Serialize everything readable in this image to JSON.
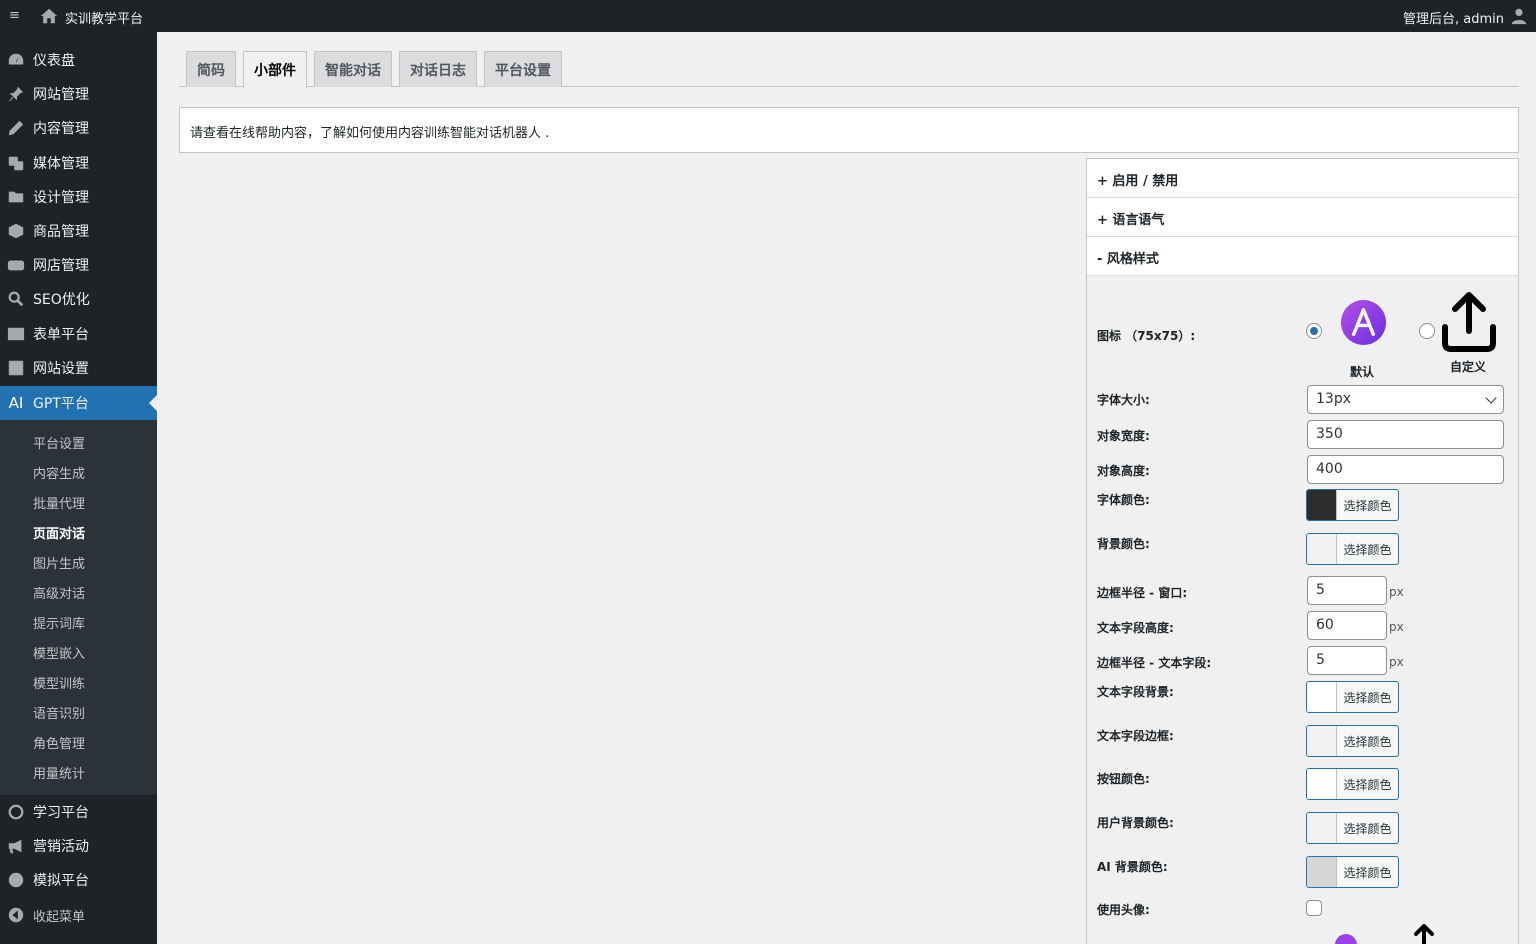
{
  "adminbar": {
    "menu_toggle_glyph": "≡",
    "site_name": "实训教学平台",
    "account_text": "管理后台, admin"
  },
  "sidebar": {
    "items": [
      {
        "label": "仪表盘",
        "icon": "dashboard-icon"
      },
      {
        "label": "网站管理",
        "icon": "pin-icon"
      },
      {
        "label": "内容管理",
        "icon": "pencil-icon"
      },
      {
        "label": "媒体管理",
        "icon": "media-icon"
      },
      {
        "label": "设计管理",
        "icon": "folder-icon"
      },
      {
        "label": "商品管理",
        "icon": "box-icon"
      },
      {
        "label": "网店管理",
        "icon": "woo-icon"
      },
      {
        "label": "SEO优化",
        "icon": "search-icon"
      },
      {
        "label": "表单平台",
        "icon": "form-icon"
      },
      {
        "label": "网站设置",
        "icon": "settings-icon"
      },
      {
        "label": "GPT平台",
        "icon": "ai-icon",
        "icon_text": "AI"
      },
      {
        "label": "学习平台",
        "icon": "learn-icon"
      },
      {
        "label": "营销活动",
        "icon": "megaphone-icon"
      },
      {
        "label": "模拟平台",
        "icon": "globe-icon"
      },
      {
        "label": "收起菜单",
        "icon": "collapse-icon"
      }
    ],
    "submenu": [
      "平台设置",
      "内容生成",
      "批量代理",
      "页面对话",
      "图片生成",
      "高级对话",
      "提示词库",
      "模型嵌入",
      "模型训练",
      "语音识别",
      "角色管理",
      "用量统计"
    ]
  },
  "tabs": [
    "简码",
    "小部件",
    "智能对话",
    "对话日志",
    "平台设置"
  ],
  "notice": "请查看在线帮助内容，了解如何使用内容训练智能对话机器人 .",
  "accordion": [
    "+ 启用 / 禁用",
    "+ 语言语气",
    "- 风格样式"
  ],
  "style": {
    "icon_label": "图标 （75x75）:",
    "default_label": "默认",
    "custom_label": "自定义",
    "font_size_label": "字体大小:",
    "font_size_value": "13px",
    "width_label": "对象宽度:",
    "width_value": "350",
    "height_label": "对象高度:",
    "height_value": "400",
    "font_color_label": "字体颜色:",
    "bg_color_label": "背景颜色:",
    "radius_window_label": "边框半径 - 窗口:",
    "radius_window_value": "5",
    "text_height_label": "文本字段高度:",
    "text_height_value": "60",
    "radius_text_label": "边框半径 - 文本字段:",
    "radius_text_value": "5",
    "text_bg_label": "文本字段背景:",
    "text_border_label": "文本字段边框:",
    "button_color_label": "按钮颜色:",
    "user_bg_label": "用户背景颜色:",
    "ai_bg_label": "AI 背景颜色:",
    "use_avatar_label": "使用头像:",
    "unit": "px",
    "choose_color": "选择颜色"
  },
  "colors": {
    "font_color": "#2c2c2c",
    "bg_color": "#f1f1f1",
    "text_bg": "#ffffff",
    "text_border": "#f1f1f1",
    "button_color": "#ffffff",
    "user_bg": "#f1f1f1",
    "ai_bg": "#d6d6d6",
    "accent": "#2271b1"
  }
}
